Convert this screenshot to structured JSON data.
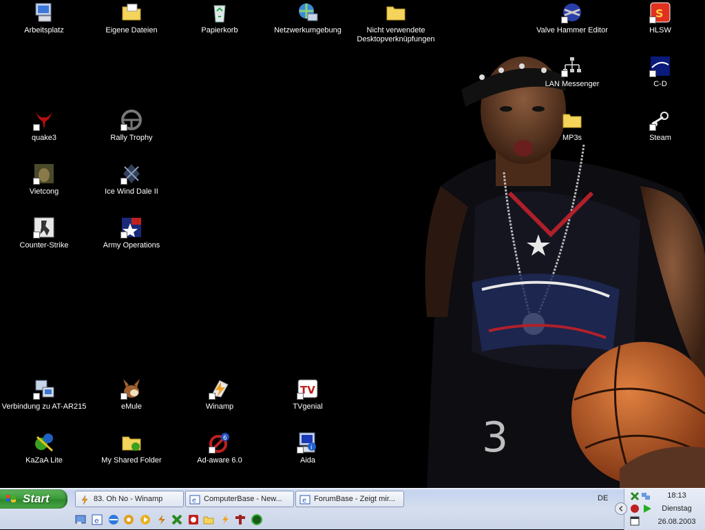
{
  "desktop": {
    "icons": [
      {
        "label": "Arbeitsplatz",
        "icon": "my-computer-icon"
      },
      {
        "label": "Eigene Dateien",
        "icon": "folder-icon"
      },
      {
        "label": "Papierkorb",
        "icon": "recycle-bin-icon"
      },
      {
        "label": "Netzwerkumgebung",
        "icon": "network-icon"
      },
      {
        "label": "Nicht verwendete Desktopverknüpfungen",
        "icon": "folder-icon"
      },
      {
        "label": "Valve Hammer Editor",
        "icon": "hammer-editor-icon"
      },
      {
        "label": "HLSW",
        "icon": "hlsw-icon"
      },
      {
        "label": "LAN Messenger",
        "icon": "lan-messenger-icon"
      },
      {
        "label": "C-D",
        "icon": "cd-icon"
      },
      {
        "label": "quake3",
        "icon": "quake3-icon"
      },
      {
        "label": "Rally Trophy",
        "icon": "steering-wheel-icon"
      },
      {
        "label": "MP3s",
        "icon": "folder-icon"
      },
      {
        "label": "Steam",
        "icon": "steam-icon"
      },
      {
        "label": "Vietcong",
        "icon": "vietcong-icon"
      },
      {
        "label": "Ice Wind Dale II",
        "icon": "icewind-dale-icon"
      },
      {
        "label": "Counter-Strike",
        "icon": "counter-strike-icon"
      },
      {
        "label": "Army Operations",
        "icon": "army-operations-icon"
      },
      {
        "label": "Verbindung zu AT-AR215",
        "icon": "dialup-connection-icon"
      },
      {
        "label": "eMule",
        "icon": "emule-icon"
      },
      {
        "label": "Winamp",
        "icon": "winamp-icon"
      },
      {
        "label": "TVgenial",
        "icon": "tvgenial-icon"
      },
      {
        "label": "KaZaA Lite",
        "icon": "kazaa-icon"
      },
      {
        "label": "My Shared Folder",
        "icon": "shared-folder-icon"
      },
      {
        "label": "Ad-aware 6.0",
        "icon": "adaware-icon"
      },
      {
        "label": "Aida",
        "icon": "aida-icon"
      }
    ]
  },
  "taskbar": {
    "start_label": "Start",
    "tasks": [
      {
        "label": "83. Oh No - Winamp",
        "icon": "winamp-icon"
      },
      {
        "label": "ComputerBase - New...",
        "icon": "ie-icon"
      },
      {
        "label": "ForumBase - Zeigt mir...",
        "icon": "ie-icon"
      }
    ],
    "quick_launch": [
      "show-desktop-icon",
      "ie-icon",
      "ie-blue-icon",
      "settings-icon",
      "media-player-icon",
      "winamp-icon",
      "kazaa-icon",
      "app-red-icon",
      "folder-icon",
      "winamp-bolt-icon",
      "hammer-icon",
      "green-circle-icon"
    ],
    "language": "DE",
    "clock": {
      "time": "18:13",
      "day": "Dienstag",
      "date": "26.08.2003"
    }
  },
  "colors": {
    "desktop_bg": "#000000",
    "start_green": "#3c9d3a",
    "taskbar": "#d6deee"
  }
}
